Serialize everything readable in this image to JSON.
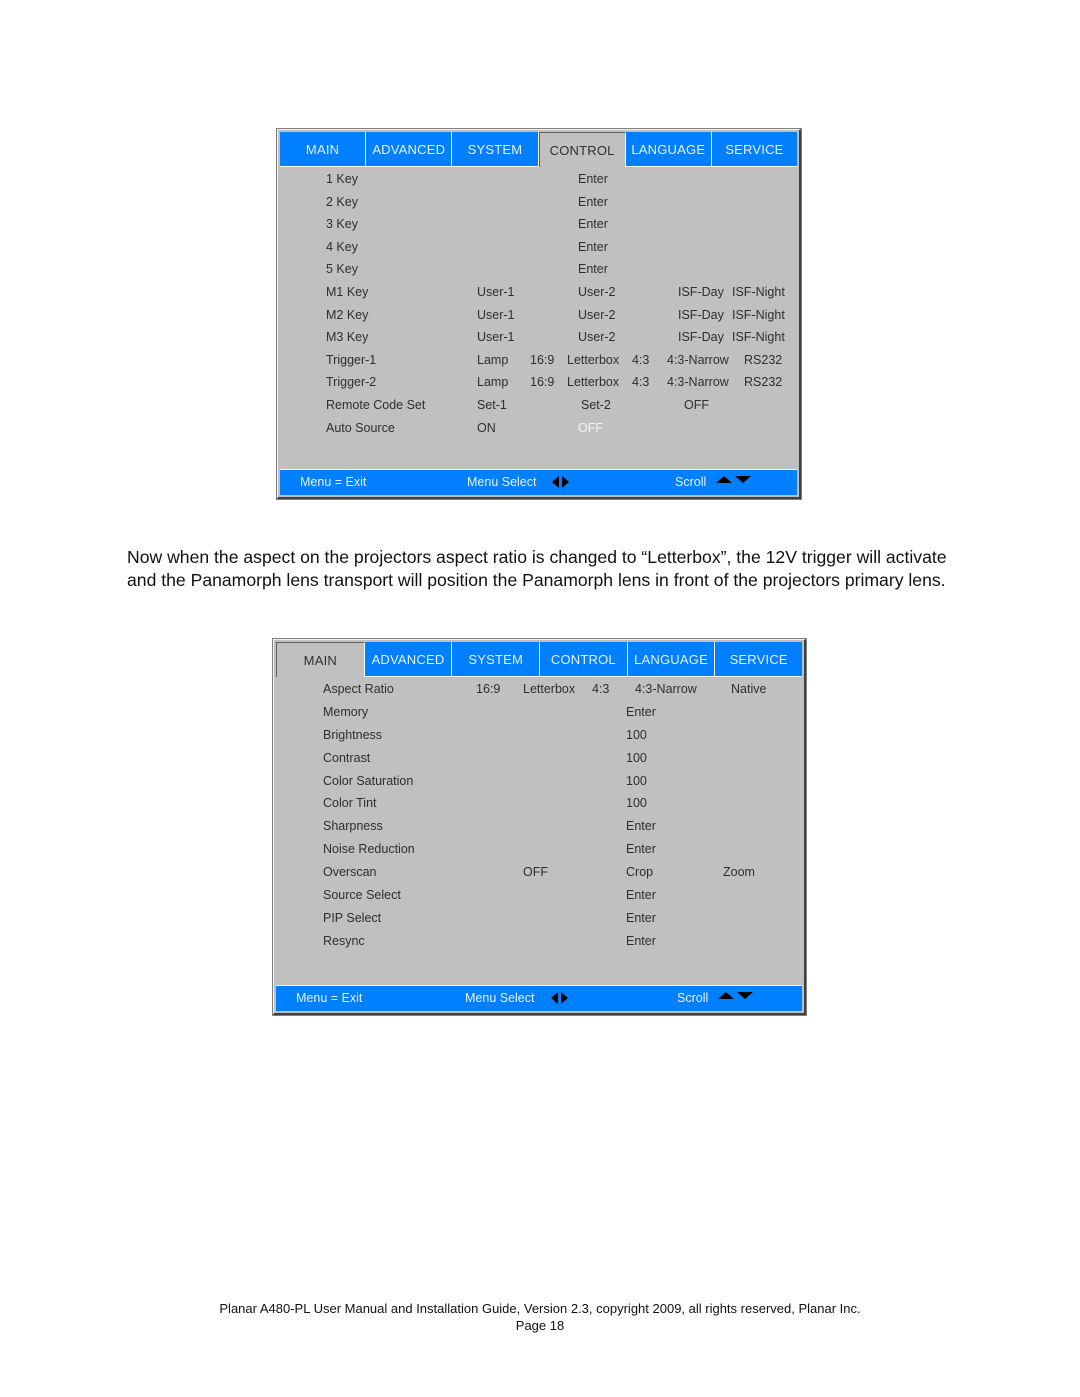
{
  "menu_control": {
    "tabs": [
      "MAIN",
      "ADVANCED",
      "SYSTEM",
      "CONTROL",
      "LANGUAGE",
      "SERVICE"
    ],
    "active_tab": "CONTROL",
    "rows": [
      {
        "label": "1 Key",
        "options": [
          "Enter"
        ]
      },
      {
        "label": "2 Key",
        "options": [
          "Enter"
        ]
      },
      {
        "label": "3 Key",
        "options": [
          "Enter"
        ]
      },
      {
        "label": "4 Key",
        "options": [
          "Enter"
        ]
      },
      {
        "label": "5 Key",
        "options": [
          "Enter"
        ]
      },
      {
        "label": "M1 Key",
        "options": [
          "User-1",
          "User-2",
          "ISF-Day",
          "ISF-Night"
        ]
      },
      {
        "label": "M2 Key",
        "options": [
          "User-1",
          "User-2",
          "ISF-Day",
          "ISF-Night"
        ]
      },
      {
        "label": "M3 Key",
        "options": [
          "User-1",
          "User-2",
          "ISF-Day",
          "ISF-Night"
        ]
      },
      {
        "label": "Trigger-1",
        "options": [
          "Lamp",
          "16:9",
          "Letterbox",
          "4:3",
          "4:3-Narrow",
          "RS232"
        ]
      },
      {
        "label": "Trigger-2",
        "options": [
          "Lamp",
          "16:9",
          "Letterbox",
          "4:3",
          "4:3-Narrow",
          "RS232"
        ]
      },
      {
        "label": "Remote Code Set",
        "options": [
          "Set-1",
          "Set-2",
          "OFF"
        ]
      },
      {
        "label": "Auto Source",
        "options": [
          "ON",
          "OFF"
        ],
        "highlighted": "OFF"
      }
    ],
    "footer": {
      "exit": "Menu = Exit",
      "select": "Menu Select",
      "scroll": "Scroll"
    }
  },
  "paragraph": "Now when the aspect on the projectors aspect ratio is changed to “Letterbox”, the 12V trigger will activate and the Panamorph lens transport will position the Panamorph lens in front of the projectors primary lens.",
  "menu_main": {
    "tabs": [
      "MAIN",
      "ADVANCED",
      "SYSTEM",
      "CONTROL",
      "LANGUAGE",
      "SERVICE"
    ],
    "active_tab": "MAIN",
    "rows": [
      {
        "label": "Aspect Ratio",
        "options": [
          "16:9",
          "Letterbox",
          "4:3",
          "4:3-Narrow",
          "Native"
        ]
      },
      {
        "label": "Memory",
        "options": [
          "Enter"
        ]
      },
      {
        "label": "Brightness",
        "options": [
          "100"
        ]
      },
      {
        "label": "Contrast",
        "options": [
          "100"
        ]
      },
      {
        "label": "Color Saturation",
        "options": [
          "100"
        ]
      },
      {
        "label": "Color Tint",
        "options": [
          "100"
        ]
      },
      {
        "label": "Sharpness",
        "options": [
          "Enter"
        ]
      },
      {
        "label": "Noise Reduction",
        "options": [
          "Enter"
        ]
      },
      {
        "label": "Overscan",
        "options": [
          "OFF",
          "Crop",
          "Zoom"
        ]
      },
      {
        "label": "Source Select",
        "options": [
          "Enter"
        ]
      },
      {
        "label": "PIP Select",
        "options": [
          "Enter"
        ]
      },
      {
        "label": "Resync",
        "options": [
          "Enter"
        ]
      }
    ],
    "footer": {
      "exit": "Menu = Exit",
      "select": "Menu Select",
      "scroll": "Scroll"
    }
  },
  "page_footer": {
    "line1": "Planar A480-PL User Manual and Installation Guide, Version 2.3, copyright 2009, all rights reserved, Planar Inc.",
    "line2": "Page 18"
  },
  "colors": {
    "menu_blue": "#0080ff",
    "menu_gray": "#c0c0c0",
    "highlight_text": "#f4f4f4"
  }
}
